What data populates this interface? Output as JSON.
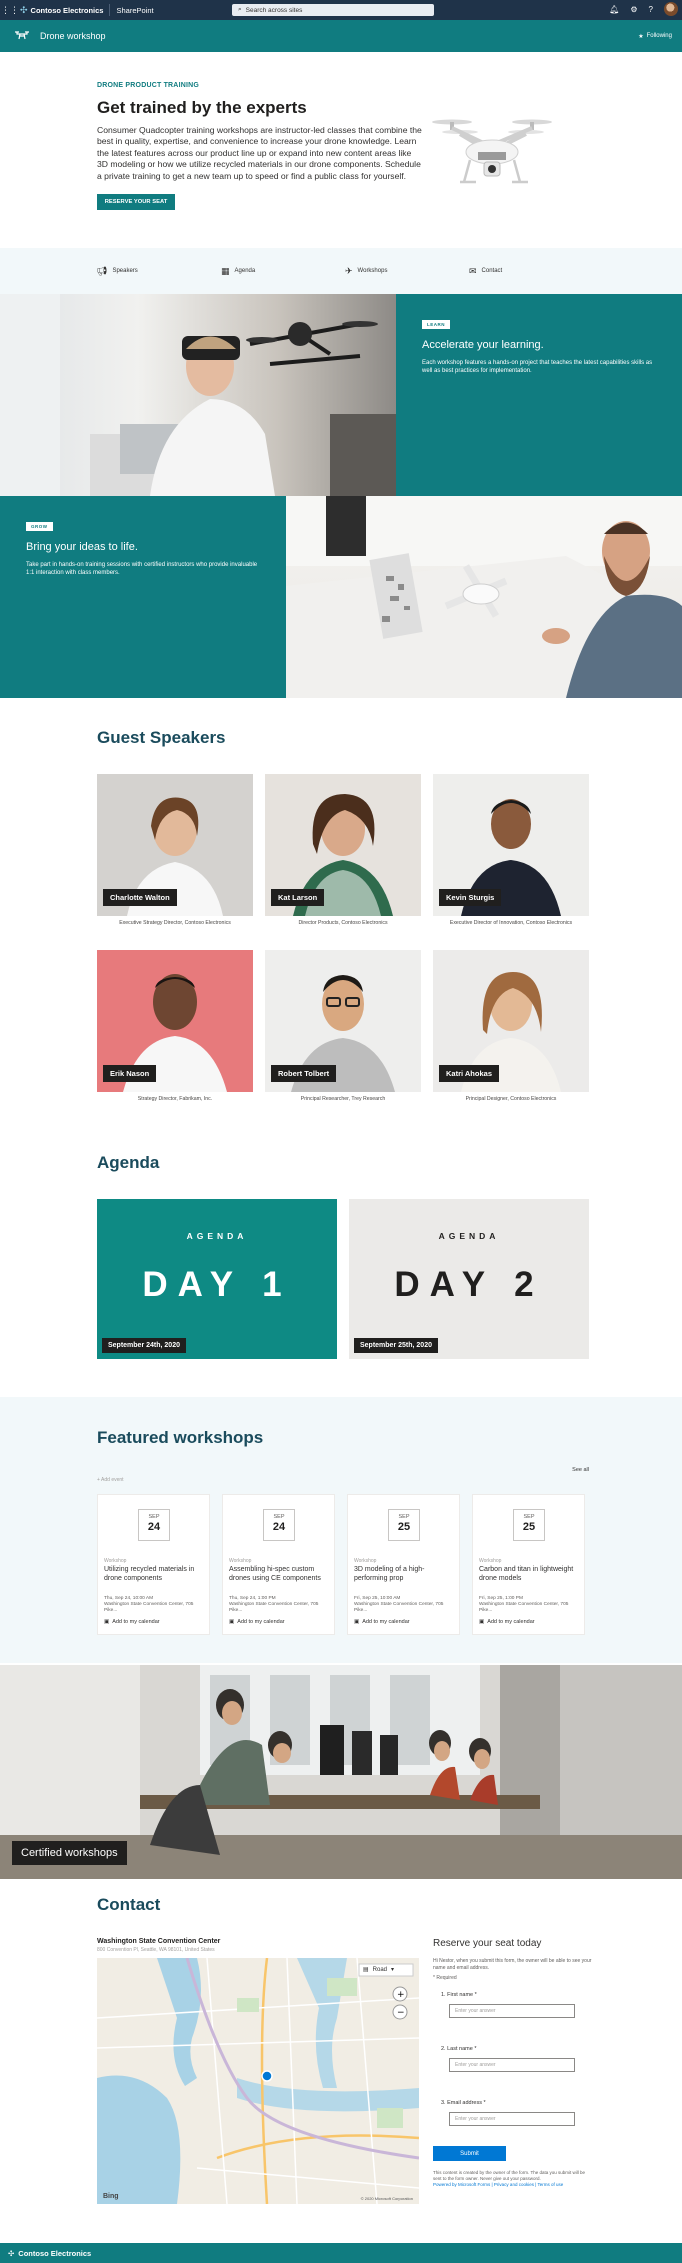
{
  "suite_bar": {
    "waffle_icon": "waffle-icon",
    "brand": "Contoso Electronics",
    "app": "SharePoint",
    "search_placeholder": "Search across sites",
    "icons": [
      "bell-icon",
      "gear-icon",
      "help-icon"
    ]
  },
  "site_header": {
    "title": "Drone workshop",
    "following": "Following"
  },
  "hero": {
    "eyebrow": "DRONE PRODUCT TRAINING",
    "title": "Get trained by the experts",
    "description": "Consumer Quadcopter training workshops are instructor-led classes that combine the best in quality, expertise, and convenience to increase your drone knowledge. Learn the latest features across our product line up or expand into new content areas like 3D modeling or how we utilize recycled materials in our drone components. Schedule a private training to get a new team up to speed or find a public class for yourself.",
    "cta": "RESERVE YOUR SEAT"
  },
  "quick_links": [
    {
      "label": "Speakers",
      "icon": "megaphone-icon"
    },
    {
      "label": "Agenda",
      "icon": "calendar-icon"
    },
    {
      "label": "Workshops",
      "icon": "drone-icon"
    },
    {
      "label": "Contact",
      "icon": "mail-icon"
    }
  ],
  "feature_learn": {
    "tag": "LEARN",
    "title": "Accelerate your learning.",
    "text": "Each workshop features a hands-on project that teaches the latest capabilities skills as well as best practices for implementation."
  },
  "feature_grow": {
    "tag": "GROW",
    "title": "Bring your ideas to life.",
    "text": "Take part in hands-on training sessions with certified instructors who provide invaluable 1:1 interaction with class members."
  },
  "speakers": {
    "title": "Guest Speakers",
    "items": [
      {
        "name": "Charlotte Walton",
        "role": "Executive Strategy Director, Contoso Electronics"
      },
      {
        "name": "Kat Larson",
        "role": "Director Products, Contoso Electronics"
      },
      {
        "name": "Kevin Sturgis",
        "role": "Executive Director of Innovation, Contoso Electronics"
      },
      {
        "name": "Erik Nason",
        "role": "Strategy Director, Fabrikam, Inc."
      },
      {
        "name": "Robert Tolbert",
        "role": "Principal Researcher, Trey Research"
      },
      {
        "name": "Katri Ahokas",
        "role": "Principal Designer, Contoso Electronics"
      }
    ]
  },
  "agenda": {
    "title": "Agenda",
    "days": [
      {
        "label": "AGENDA",
        "day": "DAY 1",
        "date": "September 24th, 2020"
      },
      {
        "label": "AGENDA",
        "day": "DAY 2",
        "date": "September 25th, 2020"
      }
    ],
    "colors": {
      "day1_bg": "#0e8a84",
      "day2_bg": "#ebeae8"
    }
  },
  "workshops": {
    "title": "Featured workshops",
    "see_all": "See all",
    "add_event": "+ Add event",
    "items": [
      {
        "month": "SEP",
        "day": "24",
        "kind": "Workshop",
        "title": "Utilizing recycled materials in drone components",
        "time": "Thu, Sep 24, 10:00 AM",
        "place": "Washington State Convention Center, 705 Pike...",
        "cal": "Add to my calendar"
      },
      {
        "month": "SEP",
        "day": "24",
        "kind": "Workshop",
        "title": "Assembling hi-spec custom drones using CE components",
        "time": "Thu, Sep 24, 1:00 PM",
        "place": "Washington State Convention Center, 705 Pike...",
        "cal": "Add to my calendar"
      },
      {
        "month": "SEP",
        "day": "25",
        "kind": "Workshop",
        "title": "3D modeling of a high-performing prop",
        "time": "Fri, Sep 25, 10:00 AM",
        "place": "Washington State Convention Center, 705 Pike...",
        "cal": "Add to my calendar"
      },
      {
        "month": "SEP",
        "day": "25",
        "kind": "Workshop",
        "title": "Carbon and titan in lightweight drone models",
        "time": "Fri, Sep 25, 1:00 PM",
        "place": "Washington State Convention Center, 705 Pike...",
        "cal": "Add to my calendar"
      }
    ]
  },
  "certified": {
    "label": "Certified workshops"
  },
  "contact": {
    "title": "Contact",
    "map_heading": "Washington State Convention Center",
    "map_address": "800 Convention Pl, Seattle, WA 98101, United States",
    "map_mode": "Road",
    "map_brand": "Bing",
    "map_copyright": "© 2020 Microsoft Corporation",
    "form": {
      "title": "Reserve your seat today",
      "intro": "Hi Nestor, when you submit this form, the owner will be able to see your name and email address.",
      "required": "* Required",
      "questions": [
        {
          "label": "1. First name *",
          "placeholder": "Enter your answer"
        },
        {
          "label": "2. Last name *",
          "placeholder": "Enter your answer"
        },
        {
          "label": "3. Email address *",
          "placeholder": "Enter your answer"
        }
      ],
      "submit": "Submit",
      "footer": "This content is created by the owner of the form. The data you submit will be sent to the form owner. Never give out your password.",
      "footer_link": "Powered by Microsoft Forms | Privacy and cookies | Terms of use"
    }
  },
  "footer": {
    "brand": "Contoso Electronics"
  },
  "colors": {
    "teal": "#107c80",
    "suite": "#1f3349",
    "band": "#f2f8fa",
    "dark_title": "#1a4b5c"
  }
}
